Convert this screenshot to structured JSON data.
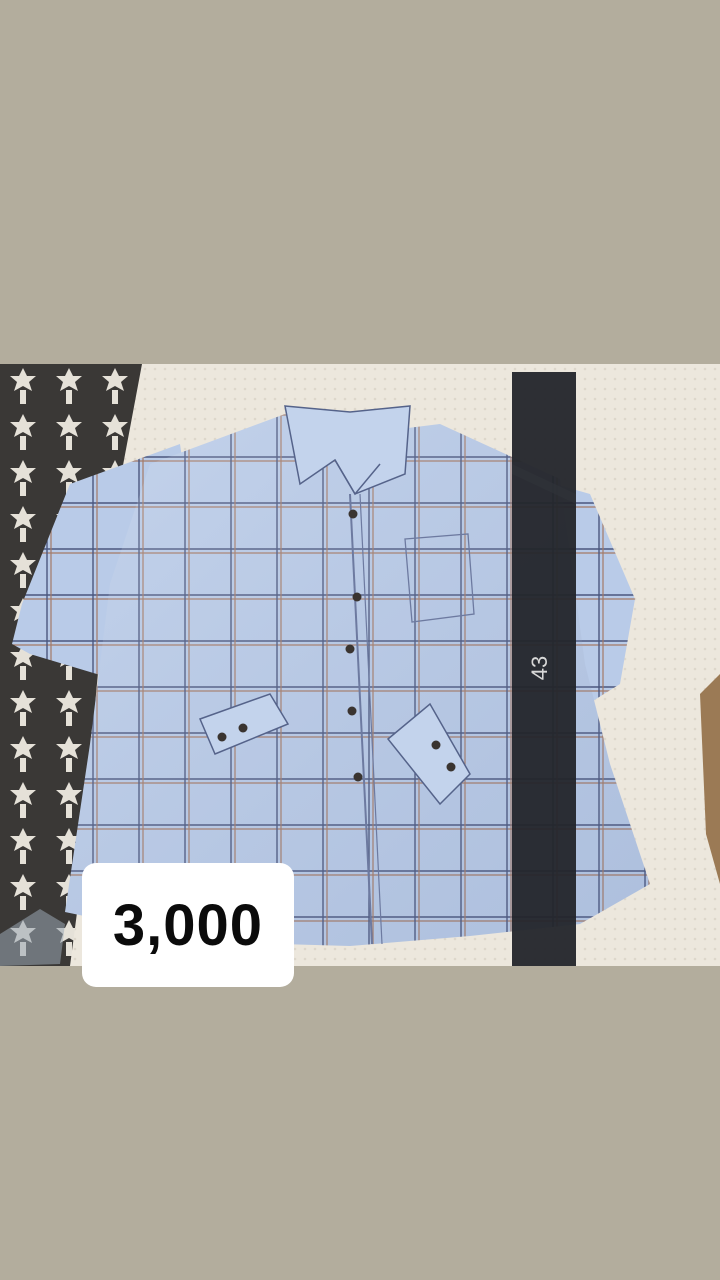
{
  "price_badge": {
    "text": "3,000"
  },
  "size_tag": {
    "text": "43"
  },
  "photo": {
    "subject": "plaid-long-sleeve-shirt",
    "colors": {
      "page_background": "#b3ad9d",
      "shirt": "#b7cae7",
      "plaid_dark": "#4b5a82",
      "plaid_brown": "#a57b68",
      "measuring_strip": "#23252a",
      "rug": "#3c3a38",
      "bedding": "#ebe6dc"
    }
  }
}
